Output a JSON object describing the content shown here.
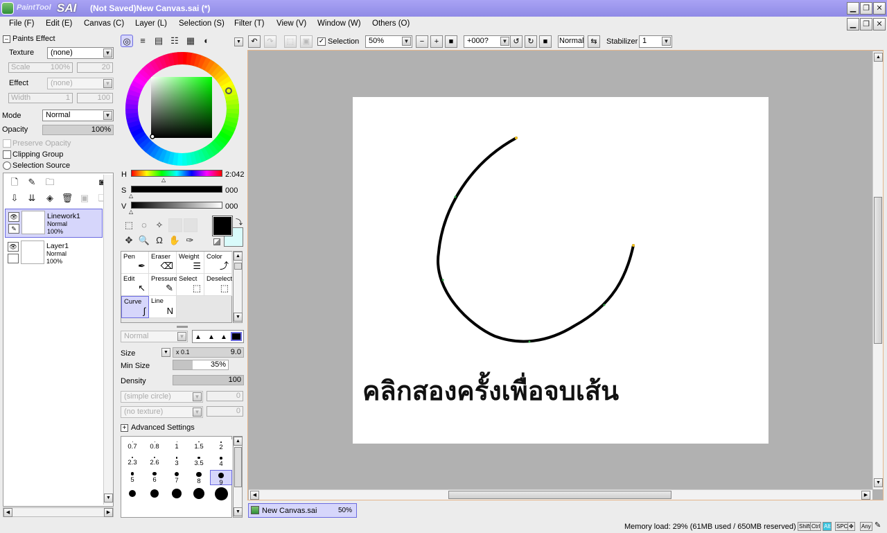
{
  "window": {
    "app_name_small": "PaintTool",
    "app_name_big": "SAI",
    "title": "(Not Saved)New Canvas.sai (*)"
  },
  "menu": [
    "File (F)",
    "Edit (E)",
    "Canvas (C)",
    "Layer (L)",
    "Selection (S)",
    "Filter (T)",
    "View (V)",
    "Window (W)",
    "Others (O)"
  ],
  "paints_effect": {
    "header": "Paints Effect",
    "texture_label": "Texture",
    "texture_value": "(none)",
    "scale_label": "Scale",
    "scale_value": "100%",
    "scale_value2": "20",
    "effect_label": "Effect",
    "effect_value": "(none)",
    "width_label": "Width",
    "width_value": "1",
    "width_value2": "100"
  },
  "layer_props": {
    "mode_label": "Mode",
    "mode_value": "Normal",
    "opacity_label": "Opacity",
    "opacity_value": "100%",
    "preserve_opacity": "Preserve Opacity",
    "clipping_group": "Clipping Group",
    "selection_source": "Selection Source"
  },
  "layers": [
    {
      "name": "Linework1",
      "mode": "Normal",
      "opacity": "100%",
      "selected": true
    },
    {
      "name": "Layer1",
      "mode": "Normal",
      "opacity": "100%",
      "selected": false
    }
  ],
  "color": {
    "h_label": "H",
    "h_value": "2:042",
    "s_label": "S",
    "s_value": "000",
    "v_label": "V",
    "v_value": "000",
    "primary": "#000000",
    "secondary": "#d9fbfb"
  },
  "tools": [
    {
      "label": "Pen",
      "glyph": "✒"
    },
    {
      "label": "Eraser",
      "glyph": "⌫"
    },
    {
      "label": "Weight",
      "glyph": "☰"
    },
    {
      "label": "Color",
      "glyph": "⤴"
    },
    {
      "label": "Edit",
      "glyph": "↖"
    },
    {
      "label": "Pressure",
      "glyph": "✎"
    },
    {
      "label": "Select",
      "glyph": "⬚"
    },
    {
      "label": "Deselect",
      "glyph": "⬚"
    },
    {
      "label": "Curve",
      "glyph": "∫",
      "selected": true
    },
    {
      "label": "Line",
      "glyph": "N"
    }
  ],
  "brush": {
    "blend_mode": "Normal",
    "size_label": "Size",
    "size_mult": "x 0.1",
    "size_value": "9.0",
    "min_size_label": "Min Size",
    "min_size_value": "35%",
    "min_size_fraction": 0.35,
    "density_label": "Density",
    "density_value": "100",
    "shape_value": "(simple circle)",
    "shape_num": "0",
    "texture_value": "(no texture)",
    "texture_num": "0",
    "advanced": "Advanced Settings"
  },
  "brush_sizes": [
    "0.7",
    "0.8",
    "1",
    "1.5",
    "2",
    "2.3",
    "2.6",
    "3",
    "3.5",
    "4",
    "5",
    "6",
    "7",
    "8",
    "9"
  ],
  "toolbar": {
    "selection_label": "Selection",
    "zoom": "50%",
    "rotation": "+000?",
    "blend": "Normal",
    "stabilizer_label": "Stabilizer",
    "stabilizer_value": "1"
  },
  "canvas": {
    "overlay_text": "คลิกสองครั้งเพื่อจบเส้น"
  },
  "doc_tab": {
    "name": "New Canvas.sai",
    "zoom": "50%"
  },
  "status": {
    "memory": "Memory load: 29% (61MB used / 650MB reserved)",
    "keys": [
      "Shift",
      "Ctrl",
      "Alt",
      "SPC",
      "✥",
      "Any",
      "✎"
    ],
    "active_key": "Alt"
  }
}
